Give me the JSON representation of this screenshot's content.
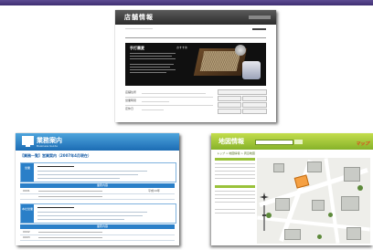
{
  "top_bar_color": "#4b3c80",
  "shop_info": {
    "header_title": "店舗情報",
    "featured_title": "手打蕎麦",
    "featured_tag": "おすすめ",
    "labels": [
      "店舗住所",
      "営業時間",
      "定休日"
    ],
    "accent": "#333333"
  },
  "business_guide": {
    "header_title": "業務案内",
    "header_subtitle": "Business Guide",
    "breadcrumb": "【業務一覧】営業案内（2007年4月現在）",
    "section_labels": [
      "営業",
      "本社営業"
    ],
    "table_header": "業務内容",
    "rows": [
      {
        "code": "0001",
        "note": "平成19年"
      },
      {
        "code": "0002",
        "note": "平成19年"
      },
      {
        "code": "0003",
        "note": "平成19年"
      }
    ],
    "accent": "#2a7fc8"
  },
  "map_info": {
    "header_title": "地図情報",
    "logo_text": "マップ",
    "breadcrumb": "トップ > 地図情報 > 周辺地図",
    "accent": "#9ac23a"
  }
}
